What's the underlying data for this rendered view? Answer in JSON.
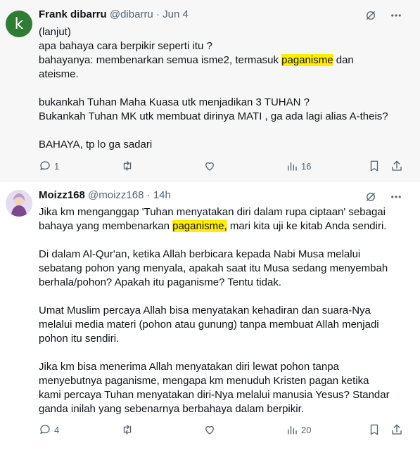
{
  "tweet1": {
    "avatar_letter": "k",
    "name": "Frank dibarru",
    "handle": "@dibarru",
    "separator": "·",
    "date": "Jun 4",
    "lines": [
      [
        "(lanjut)"
      ],
      [
        "apa bahaya cara berpikir seperti itu ?"
      ],
      [
        "bahayanya: membenarkan semua isme2, termasuk ",
        "paganisme",
        " dan"
      ],
      [
        "ateisme."
      ],
      [
        ""
      ],
      [
        "bukankah Tuhan Maha Kuasa utk menjadikan 3 TUHAN ?"
      ],
      [
        "Bukankah Tuhan MK utk membuat dirinya MATI , ga ada lagi alias A-theis?"
      ],
      [
        ""
      ],
      [
        "BAHAYA, tp lo ga sadari"
      ]
    ],
    "replies": "1",
    "views": "16"
  },
  "tweet2": {
    "name": "Moizz168",
    "handle": "@moizz168",
    "separator": "·",
    "date": "14h",
    "lines": [
      [
        "Jika km menganggap 'Tuhan menyatakan diri dalam rupa ciptaan' sebagai"
      ],
      [
        "bahaya yang membenarkan ",
        "paganisme,",
        " mari kita uji ke kitab Anda sendiri."
      ],
      [
        ""
      ],
      [
        "Di dalam Al-Qur'an, ketika Allah berbicara kepada Nabi Musa melalui"
      ],
      [
        "sebatang pohon yang menyala, apakah saat itu Musa sedang menyembah"
      ],
      [
        "berhala/pohon? Apakah itu paganisme? Tentu tidak."
      ],
      [
        ""
      ],
      [
        "Umat Muslim percaya Allah bisa menyatakan kehadiran dan suara-Nya"
      ],
      [
        "melalui media materi (pohon atau gunung) tanpa membuat Allah menjadi"
      ],
      [
        "pohon itu sendiri."
      ],
      [
        ""
      ],
      [
        "Jika km bisa menerima Allah menyatakan diri lewat pohon tanpa"
      ],
      [
        "menyebutnya paganisme, mengapa km menuduh Kristen pagan ketika"
      ],
      [
        "kami percaya Tuhan menyatakan diri-Nya melalui manusia Yesus? Standar"
      ],
      [
        "ganda inilah yang sebenarnya berbahaya dalam berpikir."
      ]
    ],
    "replies": "4",
    "views": "20"
  },
  "colors": {
    "highlight": "#ffee00",
    "muted": "#536471",
    "avatar_k": "#2e7d32"
  },
  "icons": [
    "grok-icon",
    "more-icon",
    "reply-icon",
    "retweet-icon",
    "like-icon",
    "views-icon",
    "bookmark-icon",
    "share-icon"
  ]
}
